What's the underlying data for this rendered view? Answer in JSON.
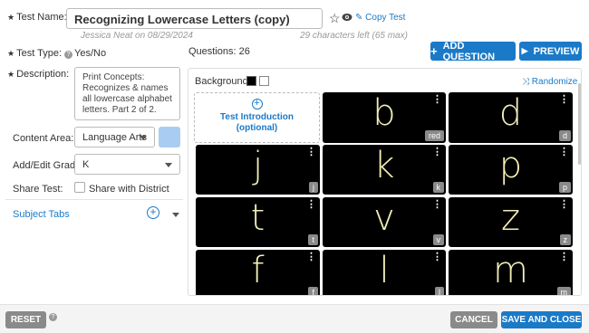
{
  "test_name": {
    "label": "Test Name:",
    "value": "Recognizing Lowercase Letters (copy)",
    "author_date": "Jessica Neat on 08/29/2024",
    "chars_left": "29 characters left (65 max)",
    "copy_test": "Copy Test"
  },
  "test_type": {
    "label": "Test Type:",
    "value": "Yes/No"
  },
  "questions": {
    "label": "Questions: 26"
  },
  "buttons": {
    "add_question": "ADD QUESTION",
    "preview": "PREVIEW",
    "reset": "RESET",
    "cancel": "CANCEL",
    "save_close": "SAVE AND CLOSE"
  },
  "description": {
    "label": "Description:",
    "value": "Print Concepts: Recognizes & names all lowercase alphabet letters. Part 2 of 2."
  },
  "content_area": {
    "label": "Content Area:",
    "value": "Language Arts",
    "swatch_color": "#a9cdf2"
  },
  "grade": {
    "label": "Add/Edit Grade:",
    "value": "K"
  },
  "share": {
    "label": "Share Test:",
    "checkbox_label": "Share with District"
  },
  "subject_tabs": {
    "label": "Subject Tabs"
  },
  "background": {
    "label": "Background:"
  },
  "randomize": "Randomize",
  "intro": {
    "title": "Test Introduction",
    "subtitle": "(optional)"
  },
  "cards": [
    {
      "letter": "b",
      "tag": "red"
    },
    {
      "letter": "d",
      "tag": "d"
    },
    {
      "letter": "j",
      "tag": "j"
    },
    {
      "letter": "k",
      "tag": "k"
    },
    {
      "letter": "p",
      "tag": "p"
    },
    {
      "letter": "t",
      "tag": "t"
    },
    {
      "letter": "v",
      "tag": "v"
    },
    {
      "letter": "z",
      "tag": "z"
    },
    {
      "letter": "f",
      "tag": "f"
    },
    {
      "letter": "l",
      "tag": "l"
    },
    {
      "letter": "m",
      "tag": "m"
    }
  ],
  "colors": {
    "accent": "#1a7ac8",
    "card_bg": "#000000",
    "letter": "#f2f0b8",
    "tag_bg": "#8a8a8a"
  }
}
